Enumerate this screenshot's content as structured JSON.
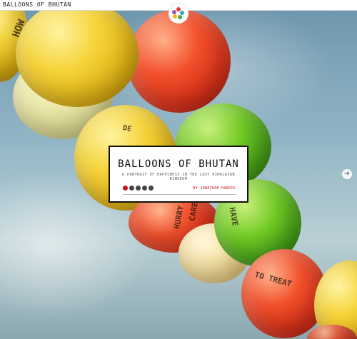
{
  "window": {
    "title": "BALLOONS OF BHUTAN"
  },
  "logo": {
    "icon": "flower-logo-icon",
    "colors": [
      "#e23b2e",
      "#3aa0d8",
      "#f2b417",
      "#4cae3d",
      "#9b59b6"
    ]
  },
  "story": {
    "title": "BALLOONS OF BHUTAN",
    "subtitle": "A PORTRAIT OF HAPPINESS IN THE LAST HIMALAYAN KINGDOM",
    "byline": "BY JONATHAN HARRIS",
    "share_icons": [
      "pinterest-icon",
      "tumblr-icon",
      "facebook-icon",
      "twitter-icon",
      "email-icon"
    ],
    "accent_color": "#c8141e"
  },
  "navigation": {
    "next_icon": "next-arrow-icon",
    "next_glyph": "➜"
  },
  "photo": {
    "balloon_texts": [
      "HOW",
      "TO TREAT",
      "HAVE",
      "DE",
      "CARE",
      "HURRY"
    ]
  }
}
